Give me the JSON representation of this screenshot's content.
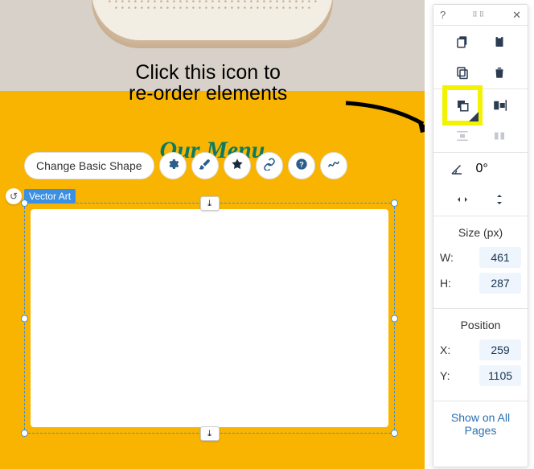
{
  "annotation": {
    "line1": "Click this icon to",
    "line2": "re-order elements"
  },
  "canvas": {
    "heading": "Our Menu",
    "selection_label": "Vector Art"
  },
  "toolbar": {
    "change_shape_label": "Change Basic Shape"
  },
  "panel": {
    "rotation_value": "0°",
    "size_title": "Size (px)",
    "w_label": "W:",
    "w_value": "461",
    "h_label": "H:",
    "h_value": "287",
    "position_title": "Position",
    "x_label": "X:",
    "x_value": "259",
    "y_label": "Y:",
    "y_value": "1105",
    "show_all_pages": "Show on All Pages"
  }
}
